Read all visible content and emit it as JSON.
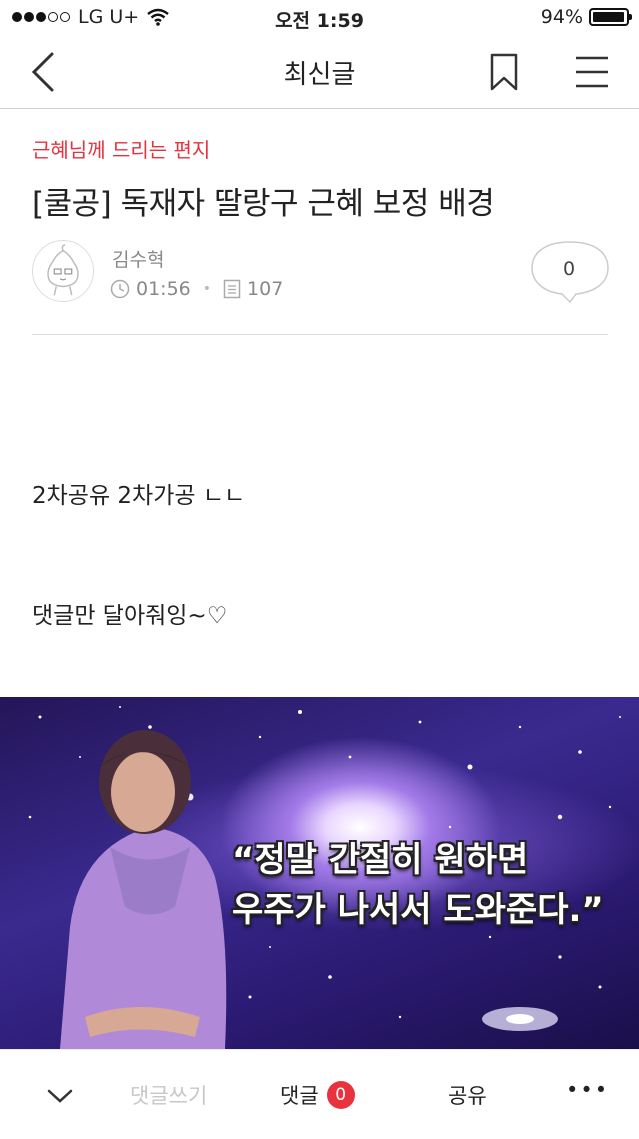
{
  "status_bar": {
    "carrier": "LG U+",
    "time": "오전 1:59",
    "battery": "94%",
    "battery_level": 0.94
  },
  "nav": {
    "title": "최신글",
    "back_icon": "chevron-left-icon",
    "bookmark_icon": "bookmark-icon",
    "menu_icon": "hamburger-menu-icon"
  },
  "post": {
    "category": "근혜님께 드리는 편지",
    "title": "[쿨공] 독재자 딸랑구 근혜 보정 배경",
    "author": "김수혁",
    "time": "01:56",
    "views": "107",
    "comment_count": "0",
    "body": [
      "2차공유 2차가공 ㄴㄴ",
      "댓글만 달아줘잉~♡"
    ],
    "image": {
      "caption_line1": "“정말 간절히 원하면",
      "caption_line2": "우주가 나서서 도와준다.”"
    }
  },
  "toolbar": {
    "write_comment": "댓글쓰기",
    "comments_label": "댓글",
    "comments_count": "0",
    "share_label": "공유",
    "more_label": "•••"
  },
  "colors": {
    "accent": "#e5323e",
    "badge": "#e8323d"
  }
}
